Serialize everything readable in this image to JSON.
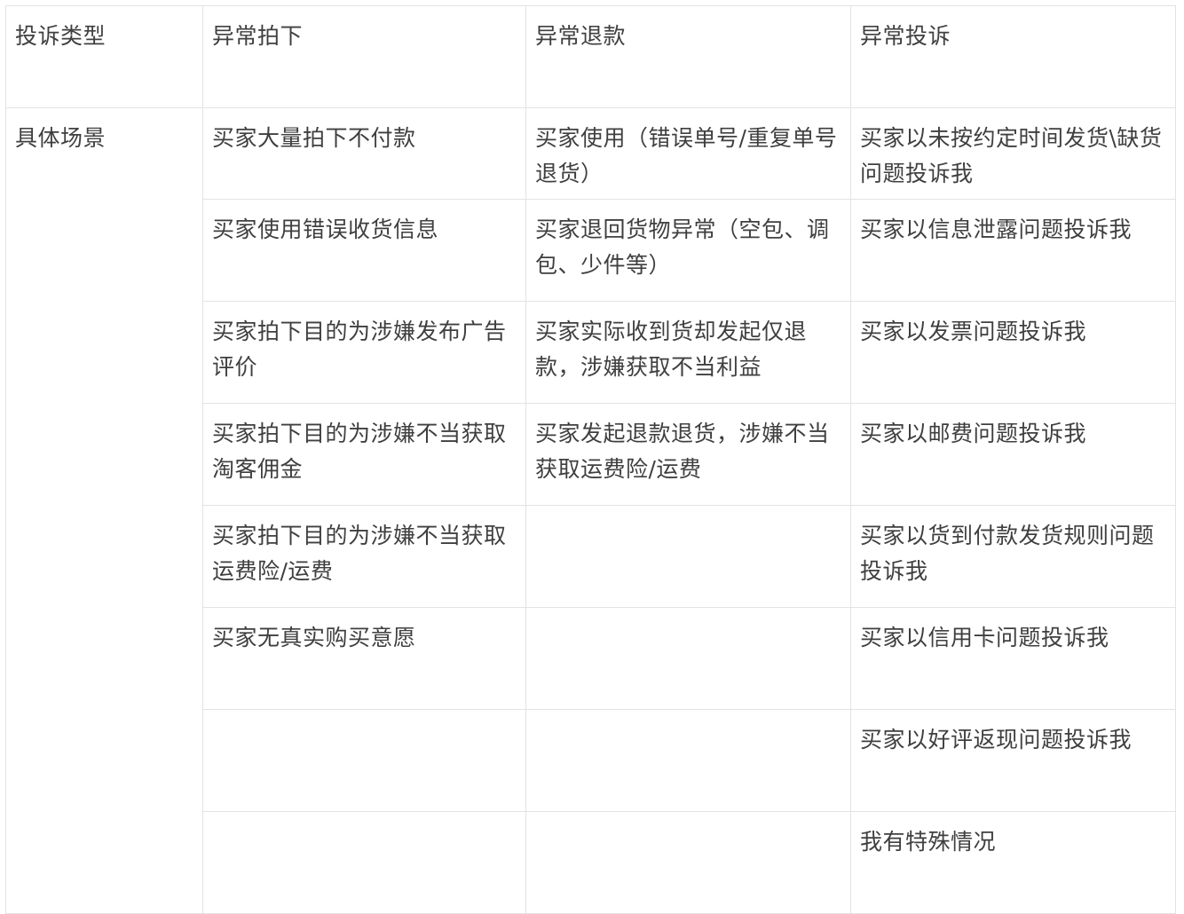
{
  "table": {
    "headers": [
      "投诉类型",
      "异常拍下",
      "异常退款",
      "异常投诉"
    ],
    "row_label": "具体场景",
    "rows": [
      [
        "买家大量拍下不付款",
        "买家使用（错误单号/重复单号退货）",
        "买家以未按约定时间发货\\缺货问题投诉我"
      ],
      [
        "买家使用错误收货信息",
        "买家退回货物异常（空包、调包、少件等）",
        "买家以信息泄露问题投诉我"
      ],
      [
        "买家拍下目的为涉嫌发布广告评价",
        "买家实际收到货却发起仅退款，涉嫌获取不当利益",
        "买家以发票问题投诉我"
      ],
      [
        "买家拍下目的为涉嫌不当获取淘客佣金",
        "买家发起退款退货，涉嫌不当获取运费险/运费",
        "买家以邮费问题投诉我"
      ],
      [
        "买家拍下目的为涉嫌不当获取运费险/运费",
        "",
        "买家以货到付款发货规则问题投诉我"
      ],
      [
        "买家无真实购买意愿",
        "",
        "买家以信用卡问题投诉我"
      ],
      [
        "",
        "",
        "买家以好评返现问题投诉我"
      ],
      [
        "",
        "",
        "我有特殊情况"
      ]
    ]
  }
}
